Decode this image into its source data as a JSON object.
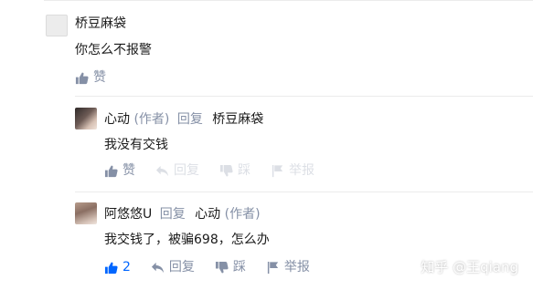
{
  "comments": [
    {
      "author": "桥豆麻袋",
      "text": "你怎么不报警",
      "like_label": "赞"
    },
    {
      "author": "心动",
      "author_tag": "(作者)",
      "reply_word": "回复",
      "reply_to": "桥豆麻袋",
      "text": "我没有交钱",
      "like_label": "赞",
      "reply_label": "回复",
      "dislike_label": "踩",
      "report_label": "举报"
    },
    {
      "author": "阿悠悠U",
      "reply_word": "回复",
      "reply_to": "心动",
      "reply_to_tag": "(作者)",
      "text": "我交钱了，被骗698，怎么办",
      "like_count": "2",
      "reply_label": "回复",
      "dislike_label": "踩",
      "report_label": "举报"
    }
  ],
  "watermark": "知乎 @王qiang",
  "colors": {
    "accent": "#0066ff",
    "muted": "#8590a6",
    "text": "#1a1a1a"
  }
}
